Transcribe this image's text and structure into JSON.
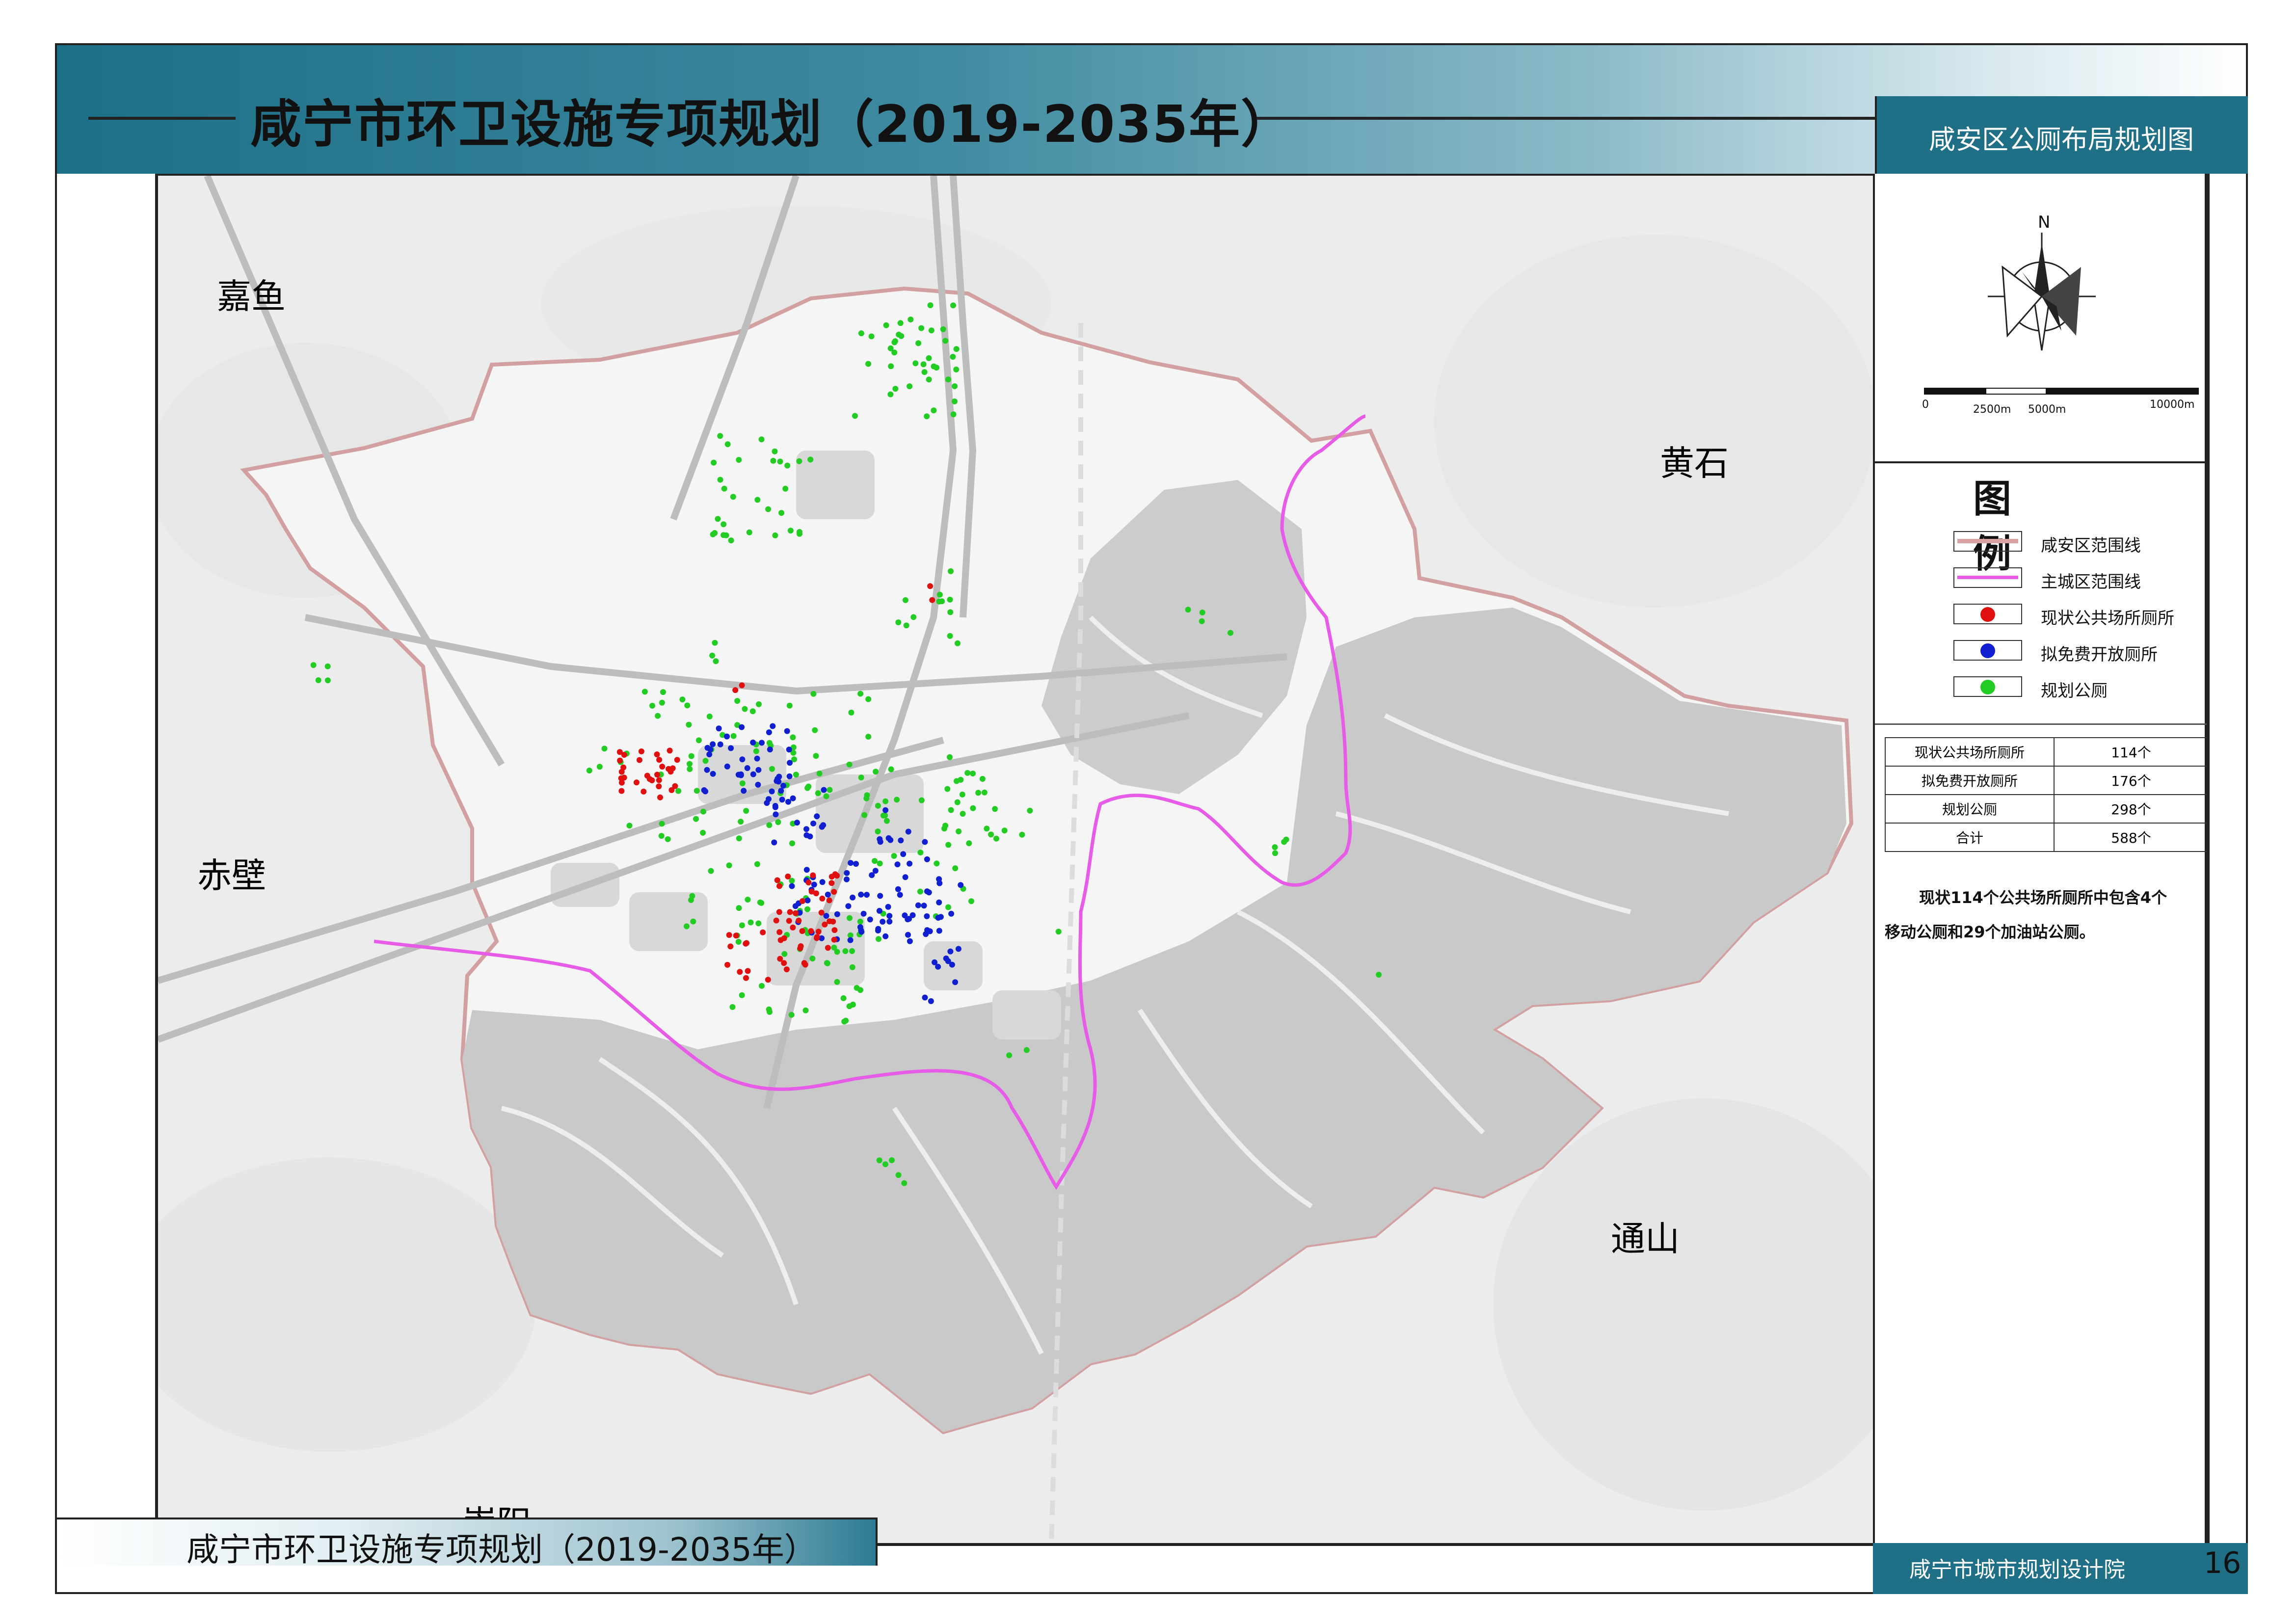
{
  "header": {
    "title": "咸宁市环卫设施专项规划（2019-2035年）",
    "sheet_title": "咸安区公厕布局规划图"
  },
  "footer": {
    "title": "咸宁市环卫设施专项规划（2019-2035年）",
    "institute": "咸宁市城市规划设计院",
    "page": "16"
  },
  "compass": {
    "north": "N"
  },
  "scale_bar": {
    "labels": [
      "0",
      "2500m",
      "5000m",
      "10000m"
    ]
  },
  "legend": {
    "title": "图　例",
    "items": [
      {
        "label": "咸安区范围线",
        "color": "#d9a3a3"
      },
      {
        "label": "主城区范围线",
        "color": "#e65ce6"
      },
      {
        "label": "现状公共场所厕所",
        "color": "#e01010"
      },
      {
        "label": "拟免费开放厕所",
        "color": "#1020d0"
      },
      {
        "label": "规划公厕",
        "color": "#22cc22"
      }
    ]
  },
  "stats": {
    "rows": [
      {
        "name": "现状公共场所厕所",
        "value": "114个"
      },
      {
        "name": "拟免费开放厕所",
        "value": "176个"
      },
      {
        "name": "规划公厕",
        "value": "298个"
      },
      {
        "name": "合计",
        "value": "588个"
      }
    ]
  },
  "note": {
    "line1": "现状114个公共场所厕所中包含4个",
    "line2": "移动公厕和29个加油站公厕。"
  },
  "map": {
    "place_names": [
      "嘉鱼",
      "黄石",
      "赤壁",
      "通山",
      "崇阳"
    ]
  }
}
